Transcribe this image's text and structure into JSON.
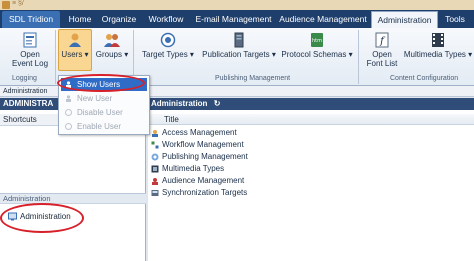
{
  "qat": {
    "text": "≡ §/"
  },
  "tabs": [
    {
      "label": "SDL Tridion"
    },
    {
      "label": "Home"
    },
    {
      "label": "Organize"
    },
    {
      "label": "Workflow"
    },
    {
      "label": "E-mail Management"
    },
    {
      "label": "Audience Management"
    },
    {
      "label": "Administration"
    },
    {
      "label": "Tools"
    }
  ],
  "ribbon": {
    "open_event_log": "Open Event Log",
    "open_event_log_l1": "Open",
    "open_event_log_l2": "Event Log",
    "users": "Users ▾",
    "groups": "Groups ▾",
    "target_types": "Target Types ▾",
    "publication_targets": "Publication Targets ▾",
    "protocol_schemas": "Protocol Schemas ▾",
    "open_font_list_l1": "Open",
    "open_font_list_l2": "Font List",
    "multimedia_types": "Multimedia Types ▾",
    "groups_labels": {
      "logging": "Logging",
      "publishing": "Publishing Management",
      "content": "Content Configuration"
    }
  },
  "breadcrumb": "Administration",
  "users_menu": [
    {
      "label": "Show Users",
      "enabled": true
    },
    {
      "label": "New User",
      "enabled": false
    },
    {
      "label": "Disable User",
      "enabled": false
    },
    {
      "label": "Enable User",
      "enabled": false
    }
  ],
  "left": {
    "header": "ADMINISTRA",
    "shortcuts": "Shortcuts",
    "section": "Administration",
    "item": "Administration"
  },
  "main": {
    "header": "Administration",
    "column": "Title",
    "rows": [
      "Access Management",
      "Workflow Management",
      "Publishing Management",
      "Multimedia Types",
      "Audience Management",
      "Synchronization Targets"
    ]
  },
  "colors": {
    "accent": "#2f4d78",
    "highlight": "#f9d792",
    "annotation": "#d8202a"
  }
}
